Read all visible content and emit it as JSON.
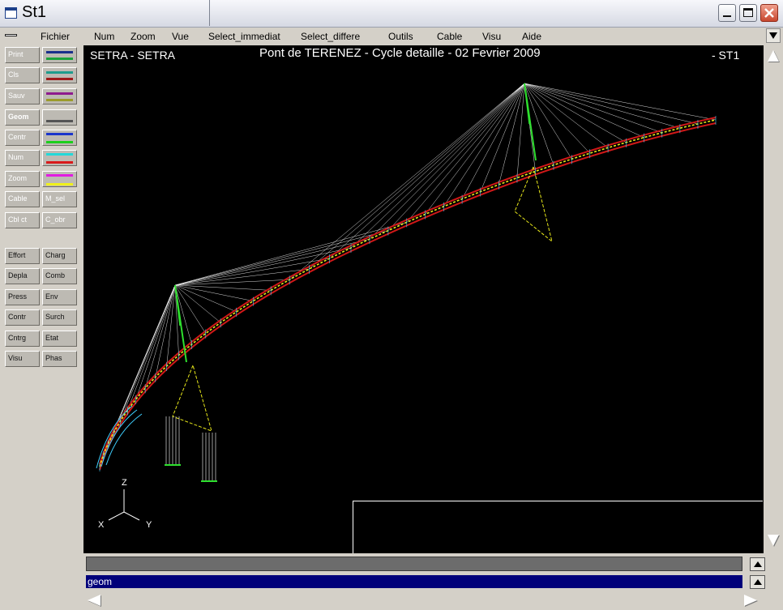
{
  "window": {
    "title": "St1"
  },
  "menu": [
    "Fichier",
    "Num",
    "Zoom",
    "Vue",
    "Select_immediat",
    "Select_differe",
    "Outils",
    "Cable",
    "Visu",
    "Aide"
  ],
  "left_panel": {
    "command_buttons": [
      "Print",
      "Cls",
      "Sauv",
      "Geom",
      "Centr",
      "Num",
      "Zoom",
      "Cable",
      "Cbl ct"
    ],
    "selection_buttons": [
      "M_sel",
      "C_obr"
    ],
    "swatch_colors": [
      "#1a2f8c",
      "#1aa33a",
      "#1f9c8c",
      "#a01a1a",
      "#8e1a8e",
      "#9b9b2a",
      "#555555",
      "#1a35cc",
      "#1ccf1c",
      "#22d9d9",
      "#d91a1a",
      "#e21ae2",
      "#f0f01a"
    ],
    "results_buttons": [
      [
        "Effort",
        "Charg"
      ],
      [
        "Depla",
        "Comb"
      ],
      [
        "Press",
        "Env"
      ],
      [
        "Contr",
        "Surch"
      ],
      [
        "Cntrg",
        "Etat"
      ],
      [
        "Visu",
        "Phas"
      ]
    ]
  },
  "viewport": {
    "left_label": "SETRA  -  SETRA",
    "title": "Pont de TERENEZ - Cycle detaille - 02 Fevrier 2009",
    "right_label": "-  ST1",
    "axes": {
      "z": "Z",
      "x": "X",
      "y": "Y"
    }
  },
  "command_line": {
    "value": "geom"
  },
  "colors": {
    "canvas_bg": "#000000",
    "command_bg": "#00007a",
    "cable": "#ffffff",
    "deck_red": "#d01818",
    "deck_yellow": "#e8e81a",
    "tower_green": "#2ee02e"
  }
}
